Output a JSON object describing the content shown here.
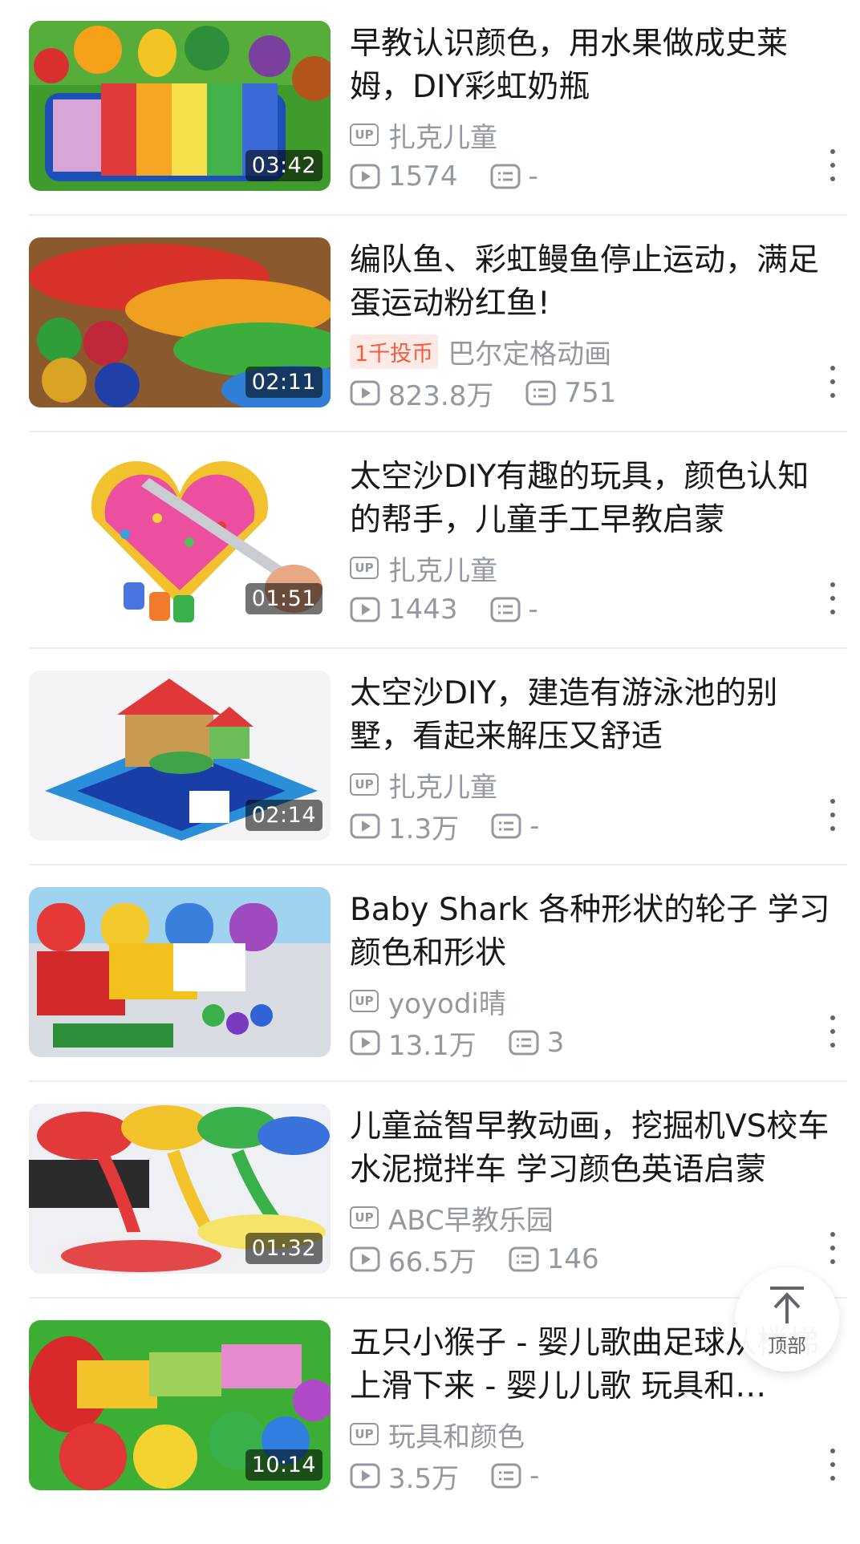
{
  "videos": [
    {
      "title": "早教认识颜色，用水果做成史莱姆，DIY彩虹奶瓶",
      "duration": "03:42",
      "uploader": "扎克儿童",
      "badge": "",
      "views": "1574",
      "comments": "-"
    },
    {
      "title": "编队鱼、彩虹鳗鱼停止运动，满足蛋运动粉红鱼!",
      "duration": "02:11",
      "uploader": "巴尔定格动画",
      "badge": "1千投币",
      "views": "823.8万",
      "comments": "751"
    },
    {
      "title": "太空沙DIY有趣的玩具，颜色认知的帮手，儿童手工早教启蒙",
      "duration": "01:51",
      "uploader": "扎克儿童",
      "badge": "",
      "views": "1443",
      "comments": "-"
    },
    {
      "title": "太空沙DIY，建造有游泳池的别墅，看起来解压又舒适",
      "duration": "02:14",
      "uploader": "扎克儿童",
      "badge": "",
      "views": "1.3万",
      "comments": "-"
    },
    {
      "title": "Baby Shark 各种形状的轮子 学习颜色和形状",
      "duration": "",
      "uploader": "yoyodi晴",
      "badge": "",
      "views": "13.1万",
      "comments": "3"
    },
    {
      "title": "儿童益智早教动画，挖掘机VS校车水泥搅拌车 学习颜色英语启蒙",
      "duration": "01:32",
      "uploader": "ABC早教乐园",
      "badge": "",
      "views": "66.5万",
      "comments": "146"
    },
    {
      "title": "五只小猴子 - 婴儿歌曲足球从楼梯上滑下来 - 婴儿儿歌 玩具和…",
      "duration": "10:14",
      "uploader": "玩具和颜色",
      "badge": "",
      "views": "3.5万",
      "comments": "-"
    }
  ],
  "up_label": "UP",
  "back_to_top": "顶部",
  "colors": {
    "meta_gray": "#9499a0",
    "title": "#18191c",
    "coin_tag": "#f25d3e"
  }
}
